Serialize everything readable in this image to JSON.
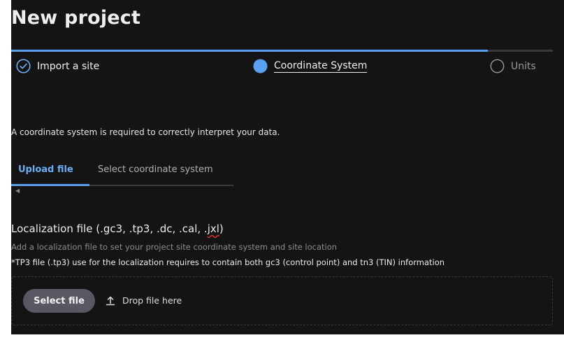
{
  "page": {
    "title": "New project"
  },
  "stepper": {
    "progress_percent": 88,
    "steps": [
      {
        "label": "Import a site",
        "state": "completed"
      },
      {
        "label": "Coordinate System",
        "state": "current"
      },
      {
        "label": "Units",
        "state": "pending"
      }
    ]
  },
  "description": "A coordinate system is required to correctly interpret your data.",
  "tabs": [
    {
      "label": "Upload file",
      "active": true
    },
    {
      "label": "Select coordinate system",
      "active": false
    }
  ],
  "localization": {
    "title_prefix": "Localization file (.gc3, .tp3, .dc, .cal, .",
    "title_flagged": "jxl",
    "title_suffix": ")",
    "hint": "Add a localization file to set your project site coordinate system and site location",
    "note": "*TP3 file (.tp3) use for the localization requires to contain both gc3 (control point) and tn3 (TIN) information"
  },
  "upload": {
    "button_label": "Select file",
    "drop_label": "Drop file here"
  },
  "colors": {
    "accent": "#5aa0f0",
    "background": "#141414",
    "button": "#585862"
  },
  "icons": {
    "completed_step": "check-circle-icon",
    "current_step": "filled-circle-icon",
    "pending_step": "empty-circle-icon",
    "upload": "upload-icon",
    "scroll_left": "caret-left-icon"
  }
}
